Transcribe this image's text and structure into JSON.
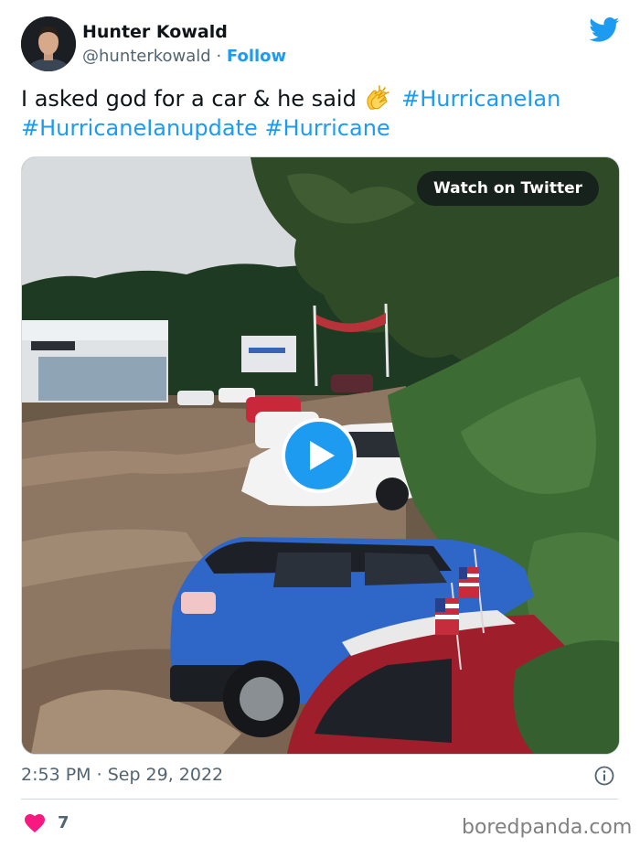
{
  "author": {
    "name": "Hunter Kowald",
    "handle": "@hunterkowald",
    "separator": " · ",
    "follow_label": "Follow"
  },
  "tweet": {
    "text_before_emoji": "I asked god for a car & he said",
    "emoji_icon": "clapping-hands-icon",
    "hashtags": [
      "#HurricaneIan",
      "#HurricaneIanupdate",
      "#Hurricane"
    ]
  },
  "media": {
    "watch_label": "Watch on Twitter",
    "play_icon": "play-icon"
  },
  "meta": {
    "time": "2:53 PM",
    "separator": " · ",
    "date": "Sep 29, 2022"
  },
  "likes": {
    "count": "7",
    "icon": "heart-icon"
  },
  "watermark": "boredpanda.com",
  "colors": {
    "accent": "#1d9bf0",
    "heart": "#f91880",
    "text": "#0f1419",
    "muted": "#536471"
  }
}
